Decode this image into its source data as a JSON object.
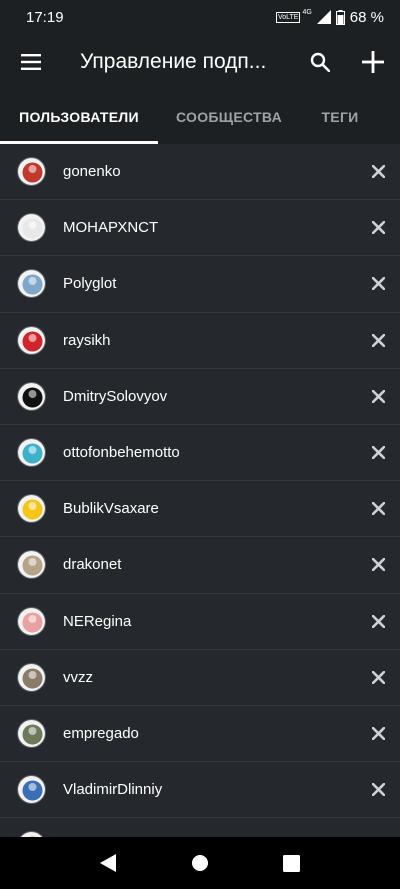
{
  "status_bar": {
    "time": "17:19",
    "volte": "VoLTE",
    "network": "4G",
    "battery": "68 %"
  },
  "app_bar": {
    "title": "Управление подп...",
    "menu_icon": "menu-icon",
    "search_icon": "search-icon",
    "add_icon": "add-icon"
  },
  "tabs": [
    {
      "label": "ПОЛЬЗОВАТЕЛИ",
      "active": true
    },
    {
      "label": "СООБЩЕСТВА",
      "active": false
    },
    {
      "label": "ТЕГИ",
      "active": false
    }
  ],
  "users": [
    {
      "name": "gonenko",
      "avatar_color": "#c0392b"
    },
    {
      "name": "МОНАРХNCT",
      "avatar_color": "#e8e8e8"
    },
    {
      "name": "Polyglot",
      "avatar_color": "#7fa7c9"
    },
    {
      "name": "raysikh",
      "avatar_color": "#d0232b"
    },
    {
      "name": "DmitrySolovyov",
      "avatar_color": "#111111"
    },
    {
      "name": "ottofonbehemotto",
      "avatar_color": "#3fb0c9"
    },
    {
      "name": "BublikVsaxare",
      "avatar_color": "#f5c518"
    },
    {
      "name": "drakonet",
      "avatar_color": "#b5a38a"
    },
    {
      "name": "NERegina",
      "avatar_color": "#e8a0a0"
    },
    {
      "name": "vvzz",
      "avatar_color": "#8a7c6a"
    },
    {
      "name": "empregado",
      "avatar_color": "#6d7a5a"
    },
    {
      "name": "VladimirDlinniy",
      "avatar_color": "#3b6fb5"
    },
    {
      "name": "",
      "avatar_color": "#c69a3a"
    }
  ],
  "nav": {
    "back_icon": "back-icon",
    "home_icon": "home-icon",
    "recents_icon": "recents-icon"
  }
}
